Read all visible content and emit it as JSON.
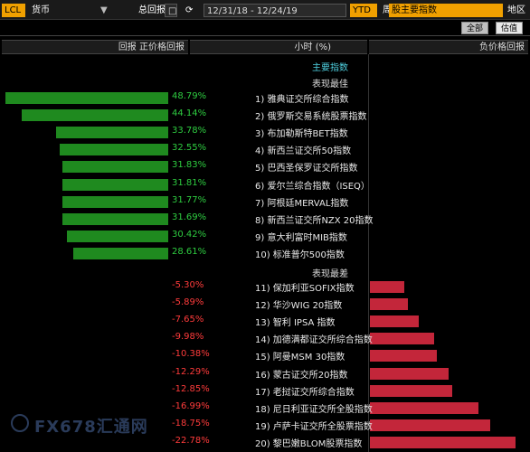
{
  "toolbar": {
    "currency_label": "货币",
    "currency_value": "LCL",
    "total_return": "总回报",
    "date_range": "12/31/18 - 12/24/19",
    "period_value": "YTD",
    "period_label": "周期",
    "index_select": "股主要指数",
    "region_label": "地区"
  },
  "tabs": {
    "valuation": "估值",
    "all": "全部"
  },
  "headers": {
    "bar_col": "回报 正价格回报",
    "change_col": "小时 (%)",
    "name_col": "负价格回报"
  },
  "sections": {
    "main_index": "主要指数",
    "best": "表现最佳",
    "worst": "表现最差"
  },
  "best_rows": [
    {
      "label": "1) 雅典证交所综合指数",
      "value": "48.79%",
      "pct": 48.79
    },
    {
      "label": "2) 俄罗斯交易系统股票指数",
      "value": "44.14%",
      "pct": 44.14
    },
    {
      "label": "3) 布加勒斯特BET指数",
      "value": "33.78%",
      "pct": 33.78
    },
    {
      "label": "4) 新西兰证交所50指数",
      "value": "32.55%",
      "pct": 32.55
    },
    {
      "label": "5) 巴西圣保罗证交所指数",
      "value": "31.83%",
      "pct": 31.83
    },
    {
      "label": "6) 爱尔兰综合指数（ISEQ）",
      "value": "31.81%",
      "pct": 31.81
    },
    {
      "label": "7) 阿根廷MERVAL指数",
      "value": "31.77%",
      "pct": 31.77
    },
    {
      "label": "8) 新西兰证交所NZX 20指数",
      "value": "31.69%",
      "pct": 31.69
    },
    {
      "label": "9) 意大利富时MIB指数",
      "value": "30.42%",
      "pct": 30.42
    },
    {
      "label": "10) 标准普尔500指数",
      "value": "28.61%",
      "pct": 28.61
    }
  ],
  "worst_rows": [
    {
      "label": "11) 保加利亚SOFIX指数",
      "value": "-5.30%",
      "pct": -5.3
    },
    {
      "label": "12) 华沙WIG 20指数",
      "value": "-5.89%",
      "pct": -5.89
    },
    {
      "label": "13) 智利 IPSA 指数",
      "value": "-7.65%",
      "pct": -7.65
    },
    {
      "label": "14) 加德满都证交所综合指数",
      "value": "-9.98%",
      "pct": -9.98
    },
    {
      "label": "15) 阿曼MSM 30指数",
      "value": "-10.38%",
      "pct": -10.38
    },
    {
      "label": "16) 蒙古证交所20指数",
      "value": "-12.29%",
      "pct": -12.29
    },
    {
      "label": "17) 老挝证交所综合指数",
      "value": "-12.85%",
      "pct": -12.85
    },
    {
      "label": "18) 尼日利亚证交所全股指数",
      "value": "-16.99%",
      "pct": -16.99
    },
    {
      "label": "19) 卢萨卡证交所全股票指数",
      "value": "-18.75%",
      "pct": -18.75
    },
    {
      "label": "20) 黎巴嫩BLOM股票指数",
      "value": "-22.78%",
      "pct": -22.78
    }
  ],
  "watermark": "FX678汇通网",
  "colors": {
    "positive": "#2ecc40",
    "negative": "#ff3b3b",
    "accent": "#f0a000"
  }
}
